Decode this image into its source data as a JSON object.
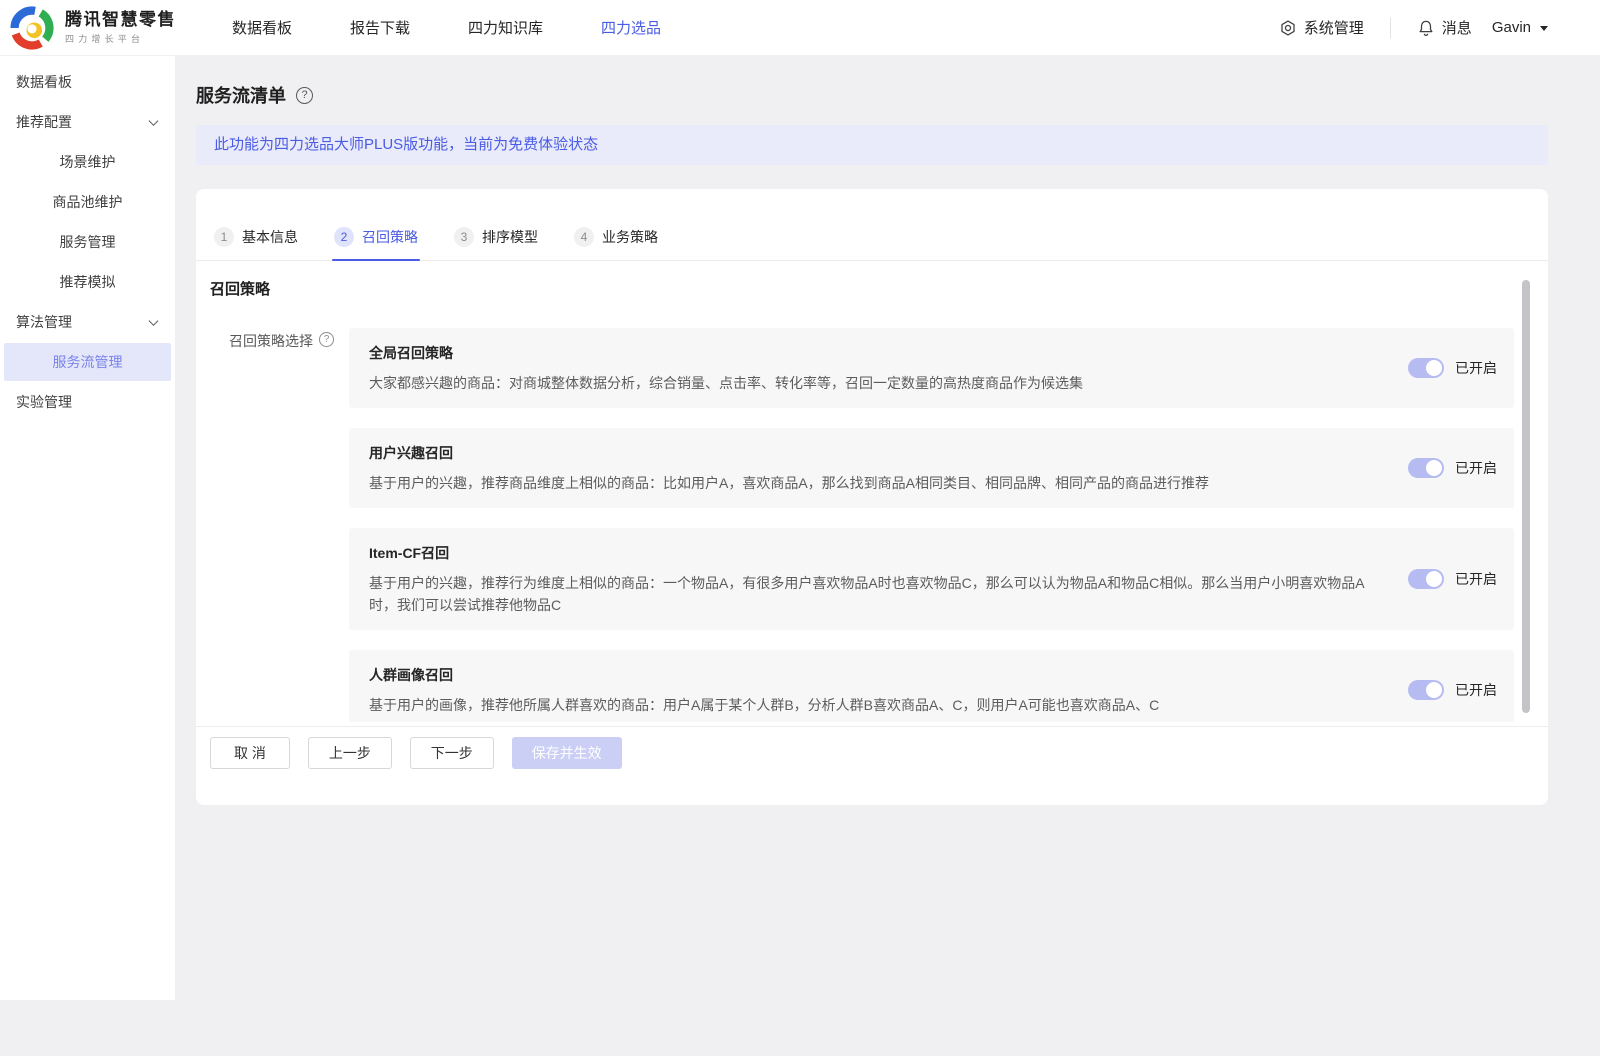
{
  "header": {
    "logo_title": "腾讯智慧零售",
    "logo_subtitle": "四力增长平台",
    "nav": [
      {
        "label": "数据看板"
      },
      {
        "label": "报告下载"
      },
      {
        "label": "四力知识库"
      },
      {
        "label": "四力选品"
      }
    ],
    "system_label": "系统管理",
    "messages_label": "消息",
    "user_name": "Gavin"
  },
  "sidebar": {
    "items": [
      {
        "label": "数据看板"
      },
      {
        "label": "推荐配置"
      },
      {
        "label": "场景维护"
      },
      {
        "label": "商品池维护"
      },
      {
        "label": "服务管理"
      },
      {
        "label": "推荐模拟"
      },
      {
        "label": "算法管理"
      },
      {
        "label": "服务流管理"
      },
      {
        "label": "实验管理"
      }
    ]
  },
  "page": {
    "title": "服务流清单",
    "banner_text": "此功能为四力选品大师PLUS版功能，当前为免费体验状态",
    "steps": [
      {
        "num": "1",
        "label": "基本信息"
      },
      {
        "num": "2",
        "label": "召回策略"
      },
      {
        "num": "3",
        "label": "排序模型"
      },
      {
        "num": "4",
        "label": "业务策略"
      }
    ],
    "section_title": "召回策略",
    "field_label": "召回策略选择",
    "strategies": [
      {
        "title": "全局召回策略",
        "desc": "大家都感兴趣的商品：对商城整体数据分析，综合销量、点击率、转化率等，召回一定数量的高热度商品作为候选集",
        "status": "已开启"
      },
      {
        "title": "用户兴趣召回",
        "desc": "基于用户的兴趣，推荐商品维度上相似的商品：比如用户A，喜欢商品A，那么找到商品A相同类目、相同品牌、相同产品的商品进行推荐",
        "status": "已开启"
      },
      {
        "title": "Item-CF召回",
        "desc": "基于用户的兴趣，推荐行为维度上相似的商品：一个物品A，有很多用户喜欢物品A时也喜欢物品C，那么可以认为物品A和物品C相似。那么当用户小明喜欢物品A时，我们可以尝试推荐他物品C",
        "status": "已开启"
      },
      {
        "title": "人群画像召回",
        "desc": "基于用户的画像，推荐他所属人群喜欢的商品：用户A属于某个人群B，分析人群B喜欢商品A、C，则用户A可能也喜欢商品A、C",
        "status": "已开启"
      }
    ],
    "footer_buttons": {
      "cancel": "取 消",
      "prev": "上一步",
      "next": "下一步",
      "save": "保存并生效"
    }
  },
  "colors": {
    "accent": "#4a5be4",
    "toggle_on": "#b6bcf1",
    "sidebar_active_bg": "#e4e7f9",
    "banner_bg": "#e9ebfa"
  }
}
